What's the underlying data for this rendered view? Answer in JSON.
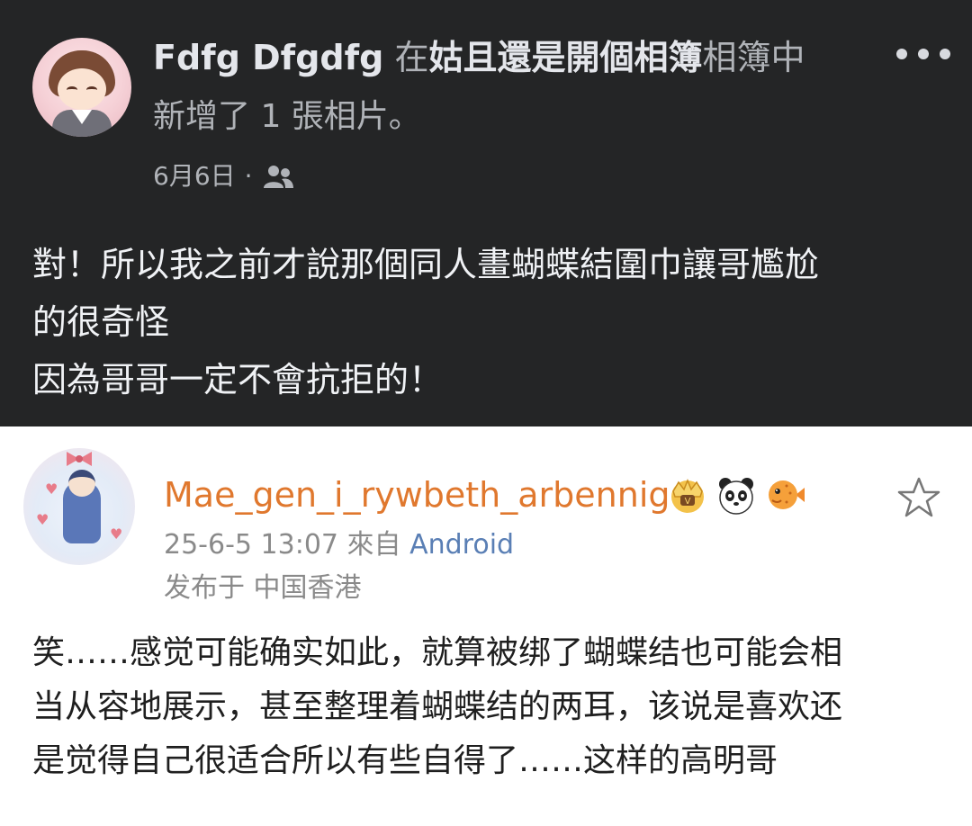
{
  "fb_post": {
    "author": "Fdfg Dfgdfg",
    "in_word": "在",
    "album_name": "姑且還是開個相簿",
    "album_suffix": "相簿中",
    "action": "新增了 1 張相片。",
    "date": "6月6日",
    "separator": "·",
    "privacy_icon": "friends-icon",
    "more_icon": "more-icon",
    "text_lines": [
      "對！所以我之前才說那個同人畫蝴蝶結圍巾讓哥尷尬",
      "的很奇怪",
      "因為哥哥一定不會抗拒的！"
    ]
  },
  "comment": {
    "username": "Mae_gen_i_rywbeth_arbennig",
    "badges": [
      "crown-badge-icon",
      "panda-badge-icon",
      "pufferfish-badge-icon"
    ],
    "timestamp": "25-6-5 13:07",
    "source_prefix": "來自",
    "source": "Android",
    "location": "发布于 中国香港",
    "star_icon": "star-icon",
    "text_lines": [
      "笑……感觉可能确实如此，就算被绑了蝴蝶结也可能会相",
      "当从容地展示，甚至整理着蝴蝶结的两耳，该说是喜欢还",
      "是觉得自己很适合所以有些自得了……这样的高明哥"
    ]
  },
  "colors": {
    "dark_bg": "#242526",
    "username_orange": "#e0782e",
    "source_blue": "#5a7fb5"
  }
}
